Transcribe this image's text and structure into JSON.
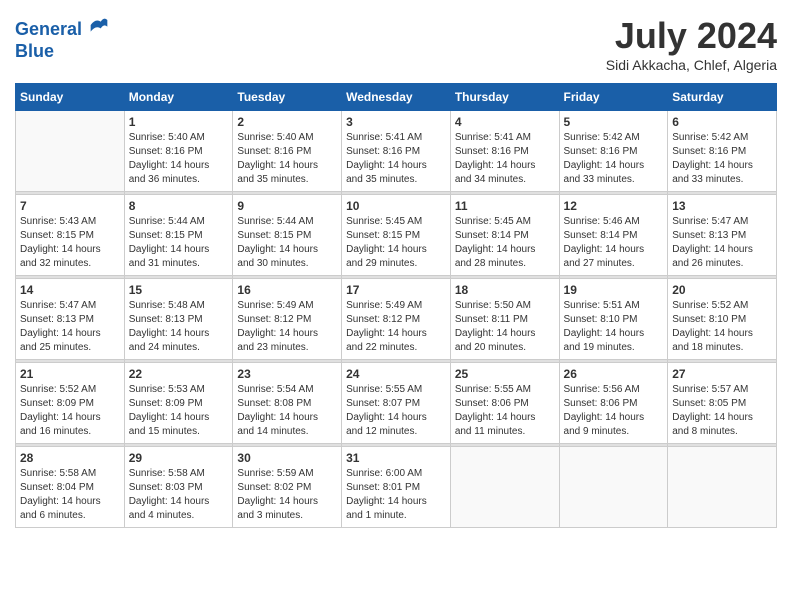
{
  "logo": {
    "line1": "General",
    "line2": "Blue"
  },
  "title": "July 2024",
  "location": "Sidi Akkacha, Chlef, Algeria",
  "days_of_week": [
    "Sunday",
    "Monday",
    "Tuesday",
    "Wednesday",
    "Thursday",
    "Friday",
    "Saturday"
  ],
  "weeks": [
    [
      {
        "day": null,
        "info": null
      },
      {
        "day": "1",
        "info": "Sunrise: 5:40 AM\nSunset: 8:16 PM\nDaylight: 14 hours\nand 36 minutes."
      },
      {
        "day": "2",
        "info": "Sunrise: 5:40 AM\nSunset: 8:16 PM\nDaylight: 14 hours\nand 35 minutes."
      },
      {
        "day": "3",
        "info": "Sunrise: 5:41 AM\nSunset: 8:16 PM\nDaylight: 14 hours\nand 35 minutes."
      },
      {
        "day": "4",
        "info": "Sunrise: 5:41 AM\nSunset: 8:16 PM\nDaylight: 14 hours\nand 34 minutes."
      },
      {
        "day": "5",
        "info": "Sunrise: 5:42 AM\nSunset: 8:16 PM\nDaylight: 14 hours\nand 33 minutes."
      },
      {
        "day": "6",
        "info": "Sunrise: 5:42 AM\nSunset: 8:16 PM\nDaylight: 14 hours\nand 33 minutes."
      }
    ],
    [
      {
        "day": "7",
        "info": "Sunrise: 5:43 AM\nSunset: 8:15 PM\nDaylight: 14 hours\nand 32 minutes."
      },
      {
        "day": "8",
        "info": "Sunrise: 5:44 AM\nSunset: 8:15 PM\nDaylight: 14 hours\nand 31 minutes."
      },
      {
        "day": "9",
        "info": "Sunrise: 5:44 AM\nSunset: 8:15 PM\nDaylight: 14 hours\nand 30 minutes."
      },
      {
        "day": "10",
        "info": "Sunrise: 5:45 AM\nSunset: 8:15 PM\nDaylight: 14 hours\nand 29 minutes."
      },
      {
        "day": "11",
        "info": "Sunrise: 5:45 AM\nSunset: 8:14 PM\nDaylight: 14 hours\nand 28 minutes."
      },
      {
        "day": "12",
        "info": "Sunrise: 5:46 AM\nSunset: 8:14 PM\nDaylight: 14 hours\nand 27 minutes."
      },
      {
        "day": "13",
        "info": "Sunrise: 5:47 AM\nSunset: 8:13 PM\nDaylight: 14 hours\nand 26 minutes."
      }
    ],
    [
      {
        "day": "14",
        "info": "Sunrise: 5:47 AM\nSunset: 8:13 PM\nDaylight: 14 hours\nand 25 minutes."
      },
      {
        "day": "15",
        "info": "Sunrise: 5:48 AM\nSunset: 8:13 PM\nDaylight: 14 hours\nand 24 minutes."
      },
      {
        "day": "16",
        "info": "Sunrise: 5:49 AM\nSunset: 8:12 PM\nDaylight: 14 hours\nand 23 minutes."
      },
      {
        "day": "17",
        "info": "Sunrise: 5:49 AM\nSunset: 8:12 PM\nDaylight: 14 hours\nand 22 minutes."
      },
      {
        "day": "18",
        "info": "Sunrise: 5:50 AM\nSunset: 8:11 PM\nDaylight: 14 hours\nand 20 minutes."
      },
      {
        "day": "19",
        "info": "Sunrise: 5:51 AM\nSunset: 8:10 PM\nDaylight: 14 hours\nand 19 minutes."
      },
      {
        "day": "20",
        "info": "Sunrise: 5:52 AM\nSunset: 8:10 PM\nDaylight: 14 hours\nand 18 minutes."
      }
    ],
    [
      {
        "day": "21",
        "info": "Sunrise: 5:52 AM\nSunset: 8:09 PM\nDaylight: 14 hours\nand 16 minutes."
      },
      {
        "day": "22",
        "info": "Sunrise: 5:53 AM\nSunset: 8:09 PM\nDaylight: 14 hours\nand 15 minutes."
      },
      {
        "day": "23",
        "info": "Sunrise: 5:54 AM\nSunset: 8:08 PM\nDaylight: 14 hours\nand 14 minutes."
      },
      {
        "day": "24",
        "info": "Sunrise: 5:55 AM\nSunset: 8:07 PM\nDaylight: 14 hours\nand 12 minutes."
      },
      {
        "day": "25",
        "info": "Sunrise: 5:55 AM\nSunset: 8:06 PM\nDaylight: 14 hours\nand 11 minutes."
      },
      {
        "day": "26",
        "info": "Sunrise: 5:56 AM\nSunset: 8:06 PM\nDaylight: 14 hours\nand 9 minutes."
      },
      {
        "day": "27",
        "info": "Sunrise: 5:57 AM\nSunset: 8:05 PM\nDaylight: 14 hours\nand 8 minutes."
      }
    ],
    [
      {
        "day": "28",
        "info": "Sunrise: 5:58 AM\nSunset: 8:04 PM\nDaylight: 14 hours\nand 6 minutes."
      },
      {
        "day": "29",
        "info": "Sunrise: 5:58 AM\nSunset: 8:03 PM\nDaylight: 14 hours\nand 4 minutes."
      },
      {
        "day": "30",
        "info": "Sunrise: 5:59 AM\nSunset: 8:02 PM\nDaylight: 14 hours\nand 3 minutes."
      },
      {
        "day": "31",
        "info": "Sunrise: 6:00 AM\nSunset: 8:01 PM\nDaylight: 14 hours\nand 1 minute."
      },
      {
        "day": null,
        "info": null
      },
      {
        "day": null,
        "info": null
      },
      {
        "day": null,
        "info": null
      }
    ]
  ]
}
